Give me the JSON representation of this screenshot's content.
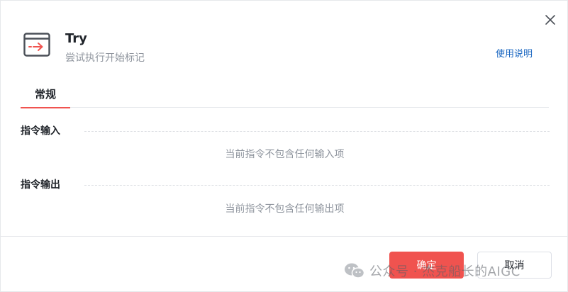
{
  "dialog": {
    "title": "Try",
    "subtitle": "尝试执行开始标记",
    "help_link": "使用说明",
    "header_icon": "terminal-arrow-icon",
    "close_icon": "close-icon"
  },
  "tabs": [
    {
      "label": "常规",
      "active": true
    }
  ],
  "sections": {
    "input": {
      "label": "指令输入",
      "empty_text": "当前指令不包含任何输入项"
    },
    "output": {
      "label": "指令输出",
      "empty_text": "当前指令不包含任何输出项"
    }
  },
  "footer": {
    "confirm_label": "确定",
    "cancel_label": "取消"
  },
  "watermark": {
    "text": "公众号 · 杰克船长的AIGC"
  },
  "colors": {
    "accent": "#f0534f",
    "link": "#1664c0",
    "muted_text": "#8f959e",
    "primary_text": "#1f2329",
    "icon_arrow": "#f0534f",
    "icon_frame": "#4a4f57"
  }
}
